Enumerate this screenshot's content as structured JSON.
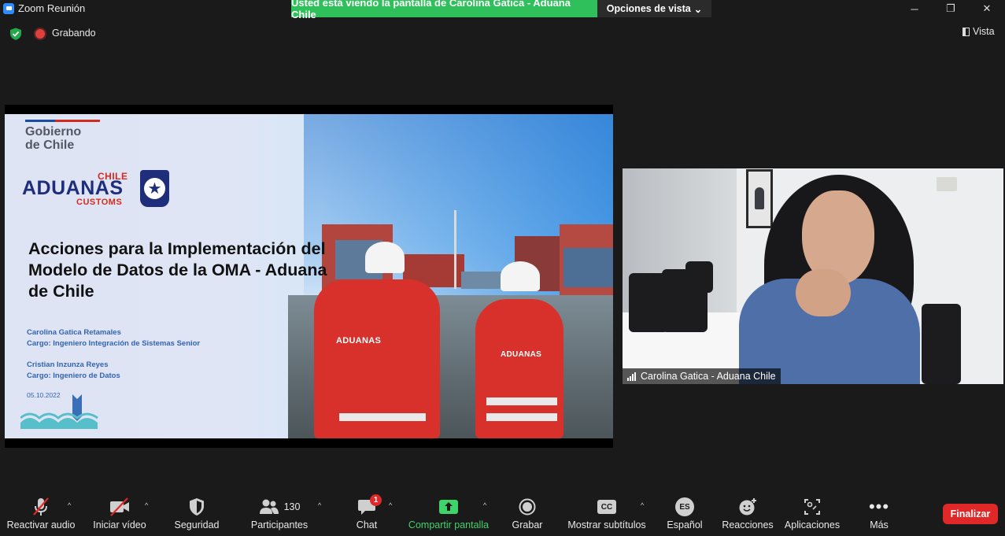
{
  "window": {
    "title": "Zoom Reunión",
    "share_banner": "Usted está viendo la pantalla de Carolina Gatica - Aduana Chile",
    "view_options": "Opciones de vista",
    "minimize": "─",
    "restore": "❐",
    "close": "✕"
  },
  "status": {
    "recording_label": "Grabando",
    "view_label": "Vista"
  },
  "slide": {
    "gov_line1": "Gobierno",
    "gov_line2": "de Chile",
    "brand_chile": "CHILE",
    "brand_main": "ADUANAS",
    "brand_customs": "CUSTOMS",
    "title": "Acciones para la Implementación del Modelo de Datos de la OMA - Aduana de Chile",
    "author1_name": "Carolina Gatica Retamales",
    "author1_role": "Cargo: Ingeniero Integración de Sistemas Senior",
    "author2_name": "Cristian Inzunza Reyes",
    "author2_role": "Cargo: Ingeniero de Datos",
    "date": "05.10.2022",
    "jacket_text": "ADUANAS"
  },
  "participant": {
    "name": "Carolina Gatica - Aduana Chile"
  },
  "toolbar": {
    "audio": "Reactivar audio",
    "video": "Iniciar vídeo",
    "security": "Seguridad",
    "participants": "Participantes",
    "participants_count": "130",
    "chat": "Chat",
    "chat_badge": "1",
    "share": "Compartir pantalla",
    "record": "Grabar",
    "captions": "Mostrar subtítulos",
    "captions_icon": "CC",
    "language": "Español",
    "language_icon": "ES",
    "reactions": "Reacciones",
    "apps": "Aplicaciones",
    "more": "Más",
    "end": "Finalizar"
  },
  "colors": {
    "share_banner": "#2fbf5b",
    "end_button": "#e02828",
    "share_icon": "#3fd36b"
  }
}
